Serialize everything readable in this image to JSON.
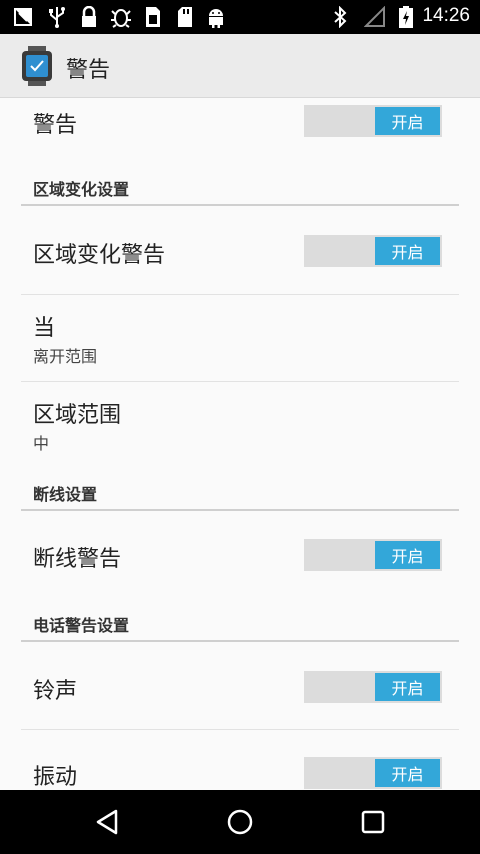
{
  "status_bar": {
    "time": "14:26",
    "left_icons": [
      "notification-icon",
      "usb-icon",
      "lock-icon",
      "bug-icon",
      "sim-icon",
      "sd-card-icon",
      "android-icon"
    ],
    "right_icons": [
      "bluetooth-icon",
      "signal-icon",
      "battery-charging-icon"
    ]
  },
  "app_bar": {
    "title": "警告"
  },
  "rows": {
    "alert": {
      "title": "警告",
      "toggle": "开启"
    },
    "zone_header": "区域变化设置",
    "zone_alert": {
      "title": "区域变化警告",
      "toggle": "开启"
    },
    "when": {
      "title": "当",
      "subtitle": "离开范围"
    },
    "zone_range": {
      "title": "区域范围",
      "subtitle": "中"
    },
    "disconnect_header": "断线设置",
    "disconnect_alert": {
      "title": "断线警告",
      "toggle": "开启"
    },
    "phone_header": "电话警告设置",
    "ringtone": {
      "title": "铃声",
      "toggle": "开启"
    },
    "vibrate": {
      "title": "振动",
      "toggle": "开启"
    }
  },
  "colors": {
    "accent": "#33a7d9",
    "toggle_track": "#dcdcdc"
  },
  "nav": [
    "back-icon",
    "home-icon",
    "recents-icon"
  ]
}
